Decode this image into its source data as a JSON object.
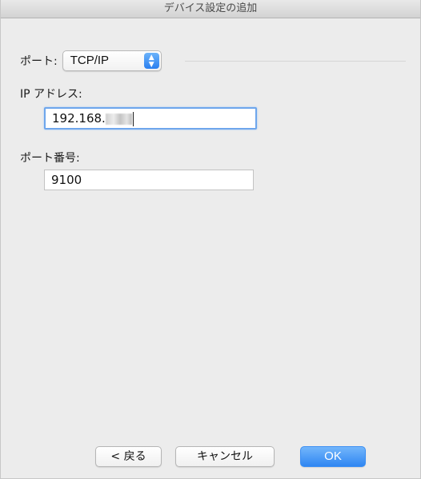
{
  "window": {
    "title": "デバイス設定の追加"
  },
  "port": {
    "label": "ポート:",
    "selected": "TCP/IP"
  },
  "ip": {
    "label": "IP アドレス:",
    "value_visible": "192.168."
  },
  "port_number": {
    "label": "ポート番号:",
    "value": "9100"
  },
  "buttons": {
    "back": "< 戻る",
    "cancel": "キャンセル",
    "ok": "OK"
  },
  "colors": {
    "accent": "#2f86f2",
    "focus_ring": "#6ea6ec"
  }
}
